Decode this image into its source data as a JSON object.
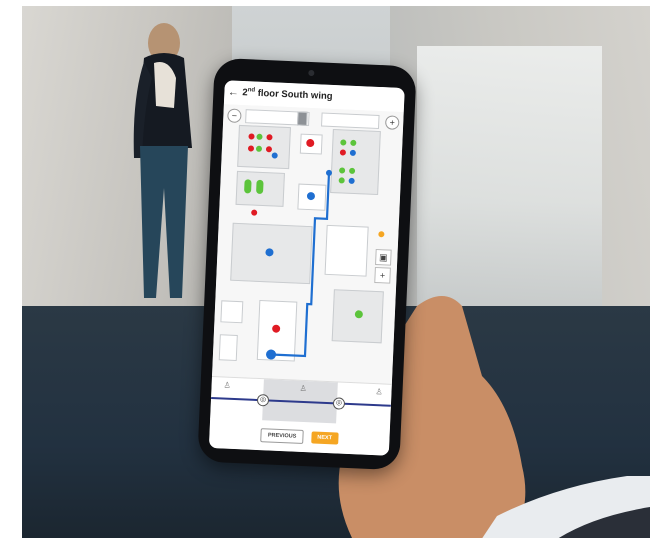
{
  "screen": {
    "title_prefix": "2",
    "title_sup": "nd",
    "title_rest": " floor South wing",
    "back_icon": "←",
    "zoom_out": "−",
    "zoom_in": "+",
    "side_plus": "+"
  },
  "footer": {
    "previous_label": "PREVIOUS",
    "next_label": "NEXT"
  },
  "colors": {
    "accent": "#f5a623",
    "route": "#1f6fd1",
    "booked": "#e01b24",
    "free": "#5cc43b",
    "nav_line": "#2d3a8c"
  }
}
